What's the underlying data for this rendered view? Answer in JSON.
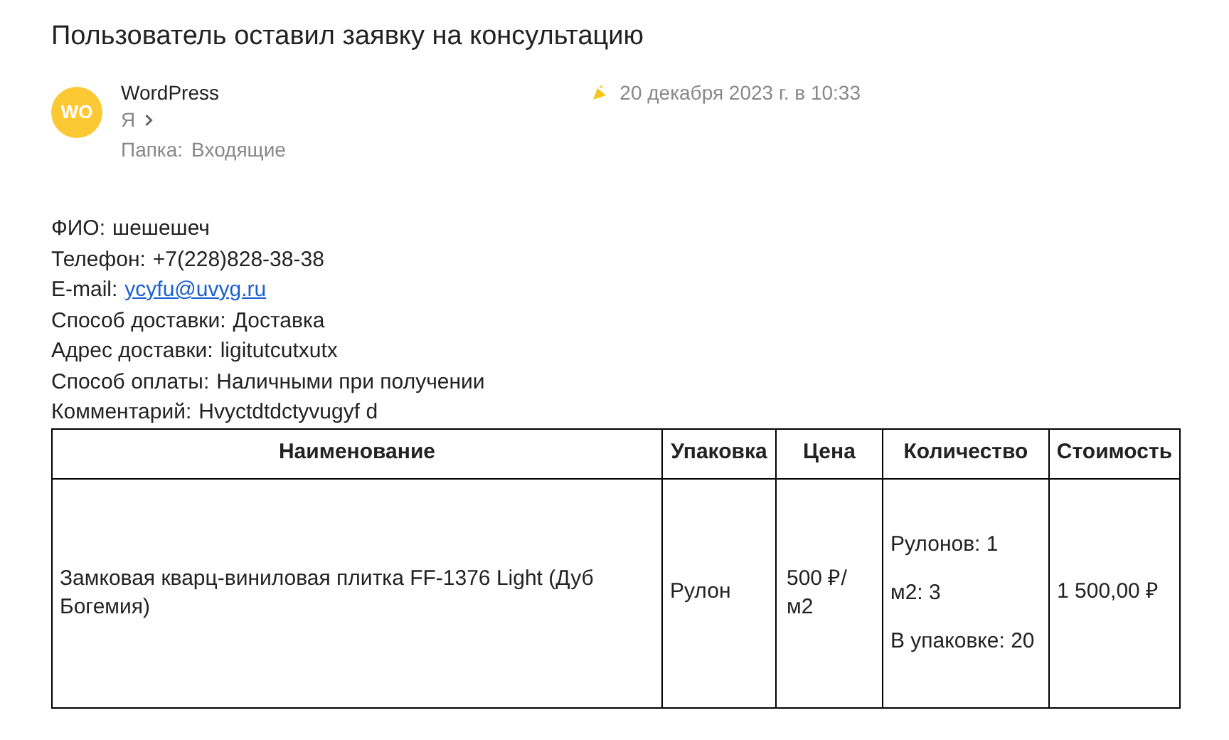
{
  "subject": "Пользователь оставил заявку на консультацию",
  "sender": {
    "avatar": "WO",
    "name": "WordPress",
    "recipient": "Я",
    "date": "20 декабря 2023 г. в 10:33",
    "folder_label": "Папка:",
    "folder": "Входящие"
  },
  "fields": [
    {
      "kind": "text",
      "label": "ФИО:",
      "value": "шешешеч"
    },
    {
      "kind": "text",
      "label": "Телефон:",
      "value": "+7(228)828-38-38"
    },
    {
      "kind": "link",
      "label": "E-mail:",
      "value": "ycyfu@uvyg.ru"
    },
    {
      "kind": "text",
      "label": "Способ доставки:",
      "value": "Доставка"
    },
    {
      "kind": "text",
      "label": "Адрес доставки:",
      "value": "ligitutcutxutx"
    },
    {
      "kind": "text",
      "label": "Способ оплаты:",
      "value": "Наличными при получении"
    },
    {
      "kind": "text",
      "label": "Комментарий:",
      "value": "Hvyctdtdctyvugyf d"
    }
  ],
  "table": {
    "columns": [
      "Наименование",
      "Упаковка",
      "Цена",
      "Количество",
      "Стоимость"
    ],
    "rows": [
      {
        "name": "Замковая кварц-виниловая плитка FF-1376 Light (Дуб Богемия)",
        "package": "Рулон",
        "price": "500 ₽/ м2",
        "quantity": [
          "Рулонов: 1",
          "м2: 3",
          "В упаковке: 20"
        ],
        "cost": "1 500,00 ₽"
      }
    ]
  }
}
